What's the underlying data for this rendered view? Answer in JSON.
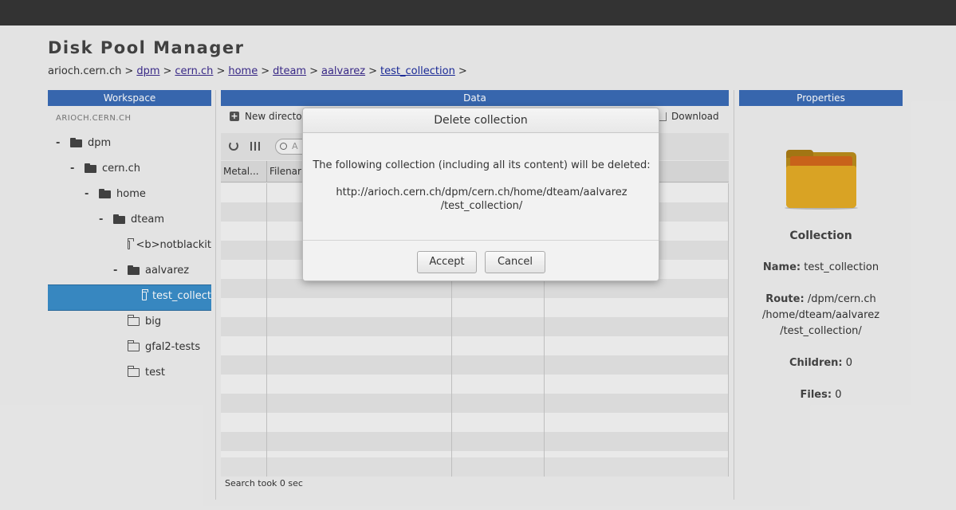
{
  "app": {
    "title": "Disk Pool Manager"
  },
  "breadcrumb": {
    "host": "arioch.cern.ch",
    "separator": ">",
    "links": [
      "dpm",
      "cern.ch",
      "home",
      "dteam",
      "aalvarez",
      "test_collection"
    ]
  },
  "panels": {
    "workspace": "Workspace",
    "data": "Data",
    "properties": "Properties"
  },
  "workspace": {
    "host": "ARIOCH.CERN.CH",
    "tree": [
      {
        "label": "dpm",
        "toggle": "-"
      },
      {
        "label": "cern.ch",
        "toggle": "-"
      },
      {
        "label": "home",
        "toggle": "-"
      },
      {
        "label": "dteam",
        "toggle": "-"
      },
      {
        "label": "<b>notblackit",
        "toggle": ""
      },
      {
        "label": "aalvarez",
        "toggle": "-"
      },
      {
        "label": "test_collect",
        "toggle": "",
        "selected": true
      },
      {
        "label": "big",
        "toggle": ""
      },
      {
        "label": "gfal2-tests",
        "toggle": ""
      },
      {
        "label": "test",
        "toggle": ""
      }
    ]
  },
  "data": {
    "toolbar": {
      "new_directory": "New directo",
      "download": "Download"
    },
    "search_placeholder": "A",
    "columns": [
      "Metal...",
      "Filenar"
    ],
    "status": "Search took 0 sec"
  },
  "properties": {
    "type": "Collection",
    "name_label": "Name:",
    "name_value": "test_collection",
    "route_label": "Route:",
    "route_lines": [
      "/dpm/cern.ch",
      "/home/dteam/aalvarez",
      "/test_collection/"
    ],
    "children_label": "Children:",
    "children_value": "0",
    "files_label": "Files:",
    "files_value": "0"
  },
  "dialog": {
    "title": "Delete collection",
    "message": "The following collection (including all its content) will be deleted:",
    "path_lines": [
      "http://arioch.cern.ch/dpm/cern.ch/home/dteam/aalvarez",
      "/test_collection/"
    ],
    "accept_label": "Accept",
    "cancel_label": "Cancel"
  },
  "colors": {
    "header_blue": "#3a6bb5",
    "selection_blue": "#3a8dc8",
    "topbar": "#333333",
    "folder_gold": "#e2aa26"
  }
}
